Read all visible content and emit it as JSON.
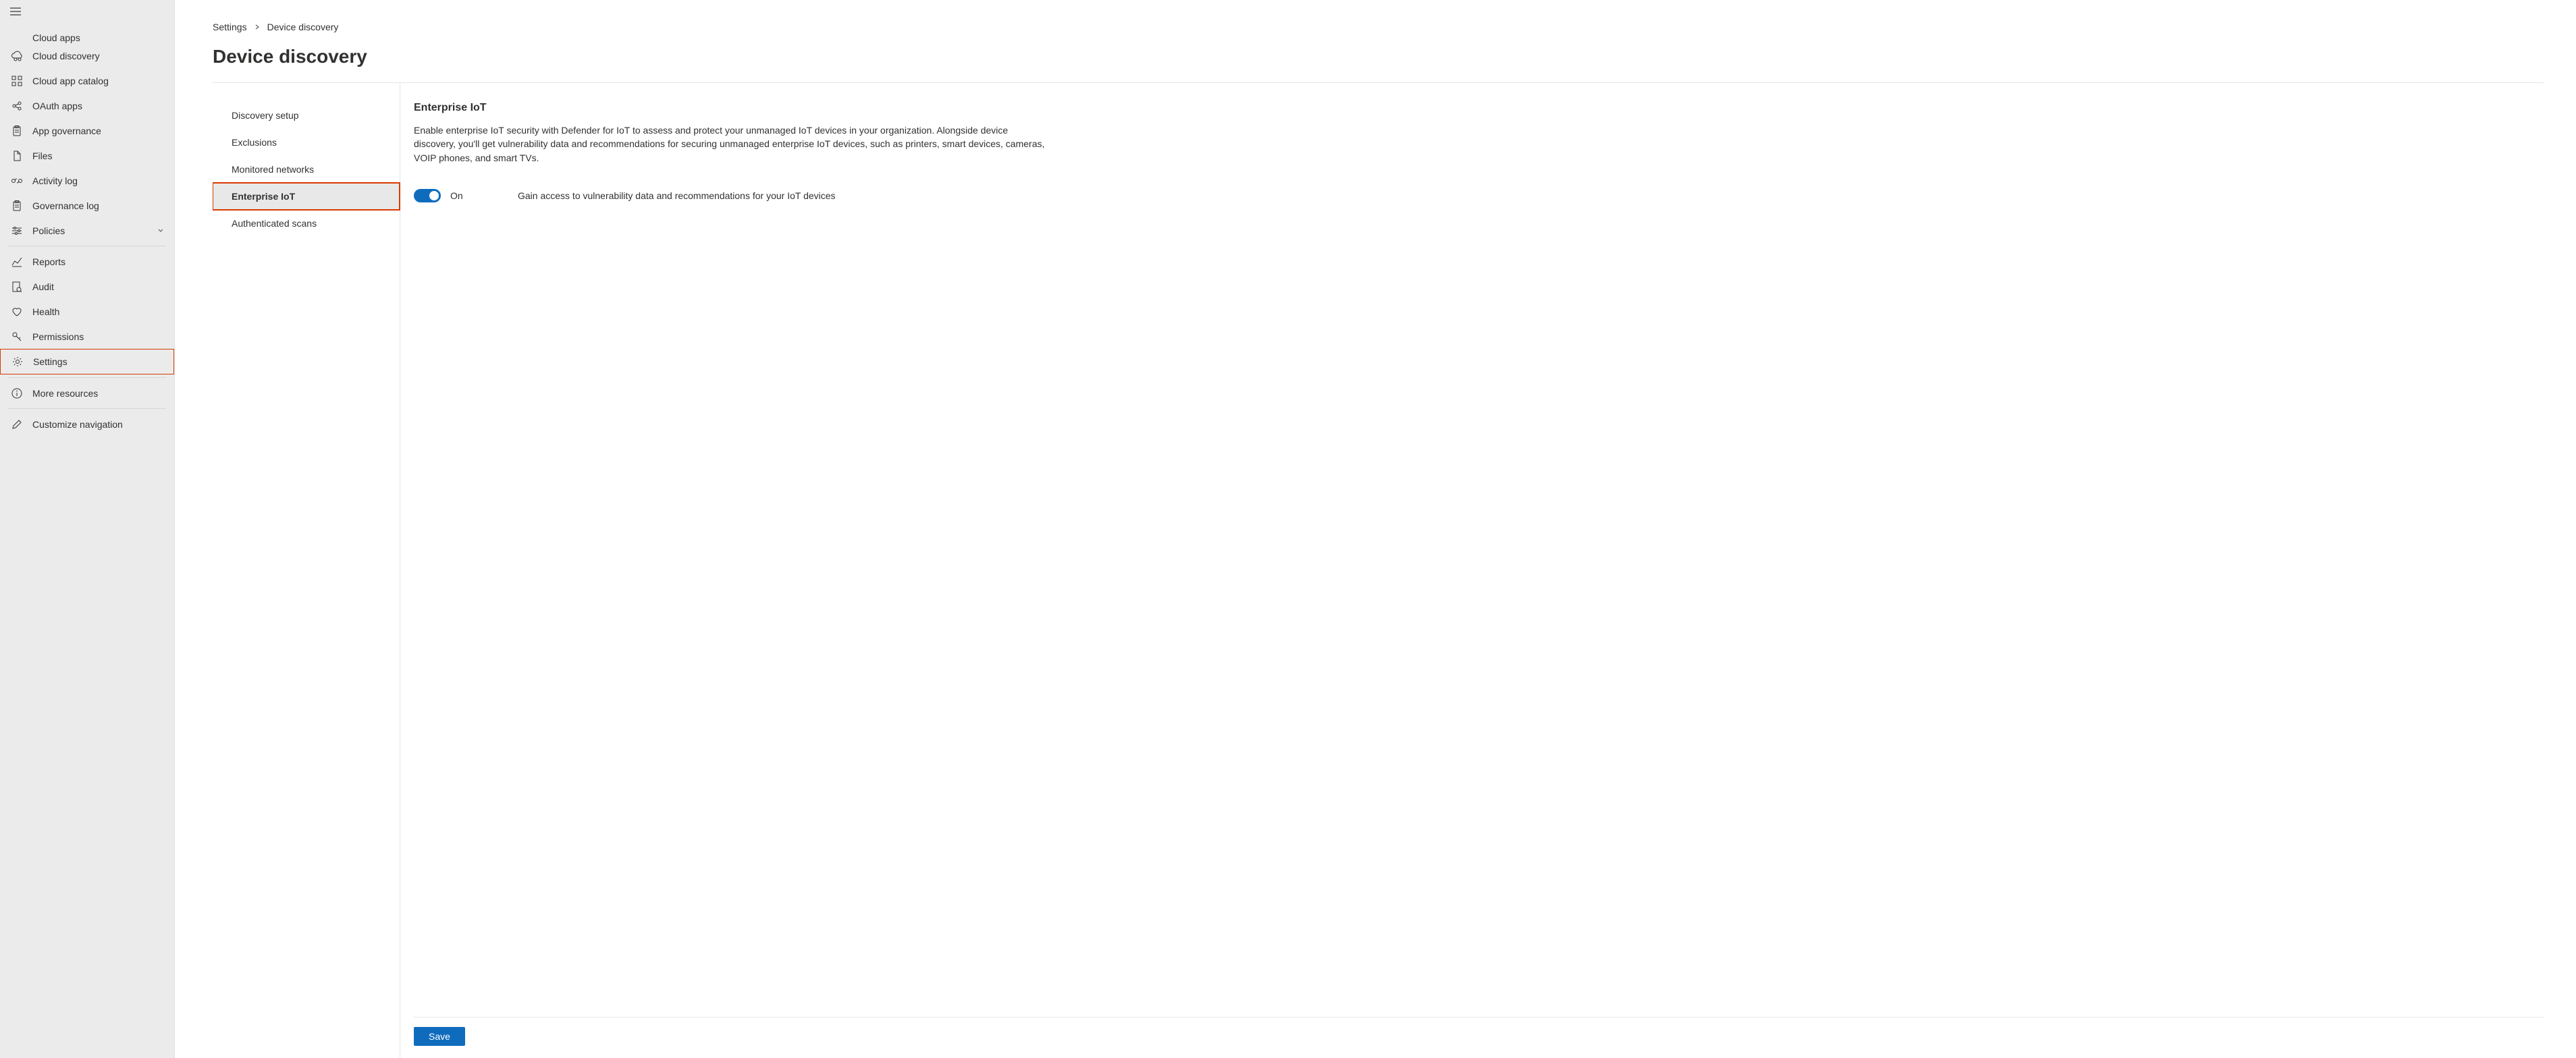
{
  "sidebar": {
    "truncated_top_label": "Cloud apps",
    "items": [
      {
        "icon": "cloud-discovery",
        "label": "Cloud discovery"
      },
      {
        "icon": "grid",
        "label": "Cloud app catalog"
      },
      {
        "icon": "oauth",
        "label": "OAuth apps"
      },
      {
        "icon": "clipboard",
        "label": "App governance"
      },
      {
        "icon": "files",
        "label": "Files"
      },
      {
        "icon": "link",
        "label": "Activity log"
      },
      {
        "icon": "clipboard",
        "label": "Governance log"
      },
      {
        "icon": "sliders",
        "label": "Policies",
        "expandable": true
      }
    ],
    "items2": [
      {
        "icon": "reports",
        "label": "Reports"
      },
      {
        "icon": "audit",
        "label": "Audit"
      },
      {
        "icon": "health",
        "label": "Health"
      },
      {
        "icon": "key",
        "label": "Permissions"
      },
      {
        "icon": "gear",
        "label": "Settings",
        "highlighted": true
      }
    ],
    "items3": [
      {
        "icon": "info",
        "label": "More resources"
      }
    ],
    "items4": [
      {
        "icon": "pencil",
        "label": "Customize navigation"
      }
    ]
  },
  "breadcrumb": {
    "parent": "Settings",
    "current": "Device discovery"
  },
  "page_title": "Device discovery",
  "subnav": [
    {
      "label": "Discovery setup"
    },
    {
      "label": "Exclusions"
    },
    {
      "label": "Monitored networks"
    },
    {
      "label": "Enterprise IoT",
      "active": true,
      "highlighted": true
    },
    {
      "label": "Authenticated scans"
    }
  ],
  "detail": {
    "section_title": "Enterprise IoT",
    "section_desc": "Enable enterprise IoT security with Defender for IoT to assess and protect your unmanaged IoT devices in your organization. Alongside device discovery, you'll get vulnerability data and recommendations for securing unmanaged enterprise IoT devices, such as printers, smart devices, cameras, VOIP phones, and smart TVs.",
    "toggle_state": "On",
    "toggle_desc": "Gain access to vulnerability data and recommendations for your IoT devices",
    "save_label": "Save"
  }
}
